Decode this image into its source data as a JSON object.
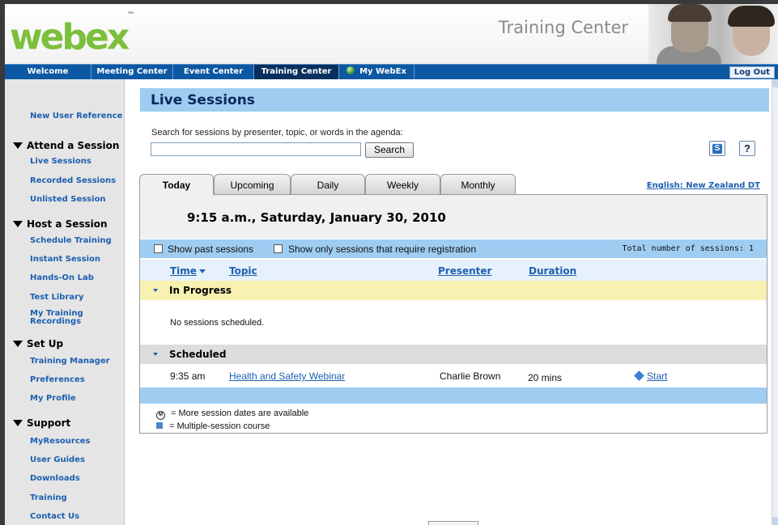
{
  "header": {
    "logo": "webex",
    "logo_mark": "™",
    "product": "Training Center"
  },
  "nav": {
    "items": [
      {
        "label": "Welcome"
      },
      {
        "label": "Meeting Center"
      },
      {
        "label": "Event Center"
      },
      {
        "label": "Training Center"
      },
      {
        "label": "My WebEx"
      }
    ],
    "logout": "Log Out"
  },
  "sidebar": {
    "new_user_reference": "New User Reference",
    "attend": {
      "heading": "Attend a Session",
      "items": [
        "Live Sessions",
        "Recorded Sessions",
        "Unlisted Session"
      ]
    },
    "host": {
      "heading": "Host a Session",
      "items": [
        "Schedule Training",
        "Instant Session",
        "Hands-On Lab",
        "Test Library",
        "My Training",
        "Recordings"
      ]
    },
    "setup": {
      "heading": "Set Up",
      "items": [
        "Training Manager",
        "Preferences",
        "My Profile"
      ]
    },
    "support": {
      "heading": "Support",
      "items": [
        "MyResources",
        "User Guides",
        "Downloads",
        "Training",
        "Contact Us"
      ]
    }
  },
  "main": {
    "title": "Live Sessions",
    "search": {
      "label": "Search for sessions by presenter, topic, or words in the agenda:",
      "value": "",
      "button": "Search"
    },
    "help_label": "?",
    "refresh_glyph": "S",
    "tabs": [
      {
        "label": "Today"
      },
      {
        "label": "Upcoming"
      },
      {
        "label": "Daily"
      },
      {
        "label": "Weekly"
      },
      {
        "label": "Monthly"
      }
    ],
    "language": "English",
    "lang_sep": ":",
    "timezone": "New Zealand DT",
    "date_heading": "9:15 a.m., Saturday, January 30, 2010",
    "filters": {
      "show_past": "Show past sessions",
      "show_registration": "Show only sessions that require registration",
      "total": "Total number of sessions: 1"
    },
    "columns": {
      "time": "Time",
      "topic": "Topic",
      "presenter": "Presenter",
      "duration": "Duration"
    },
    "groups": {
      "in_progress": "In Progress",
      "no_sessions": "No sessions scheduled.",
      "scheduled": "Scheduled"
    },
    "sessions": [
      {
        "time": "9:35 am",
        "topic": "Health and Safety Webinar",
        "presenter": "Charlie Brown",
        "duration": "20 mins",
        "action": "Start"
      }
    ],
    "legend": {
      "more_dates_mark": "M",
      "more_dates": "= More session dates are available",
      "multi_session": "= Multiple-session course"
    }
  },
  "colors": {
    "nav_bg": "#0c58a3",
    "nav_active": "#082f5d",
    "title_bar": "#9fcdf2",
    "link": "#1d5fb0",
    "in_progress_bg": "#f7f2b2",
    "scheduled_bg": "#dddddd",
    "logo_green": "#7cbf3c"
  }
}
